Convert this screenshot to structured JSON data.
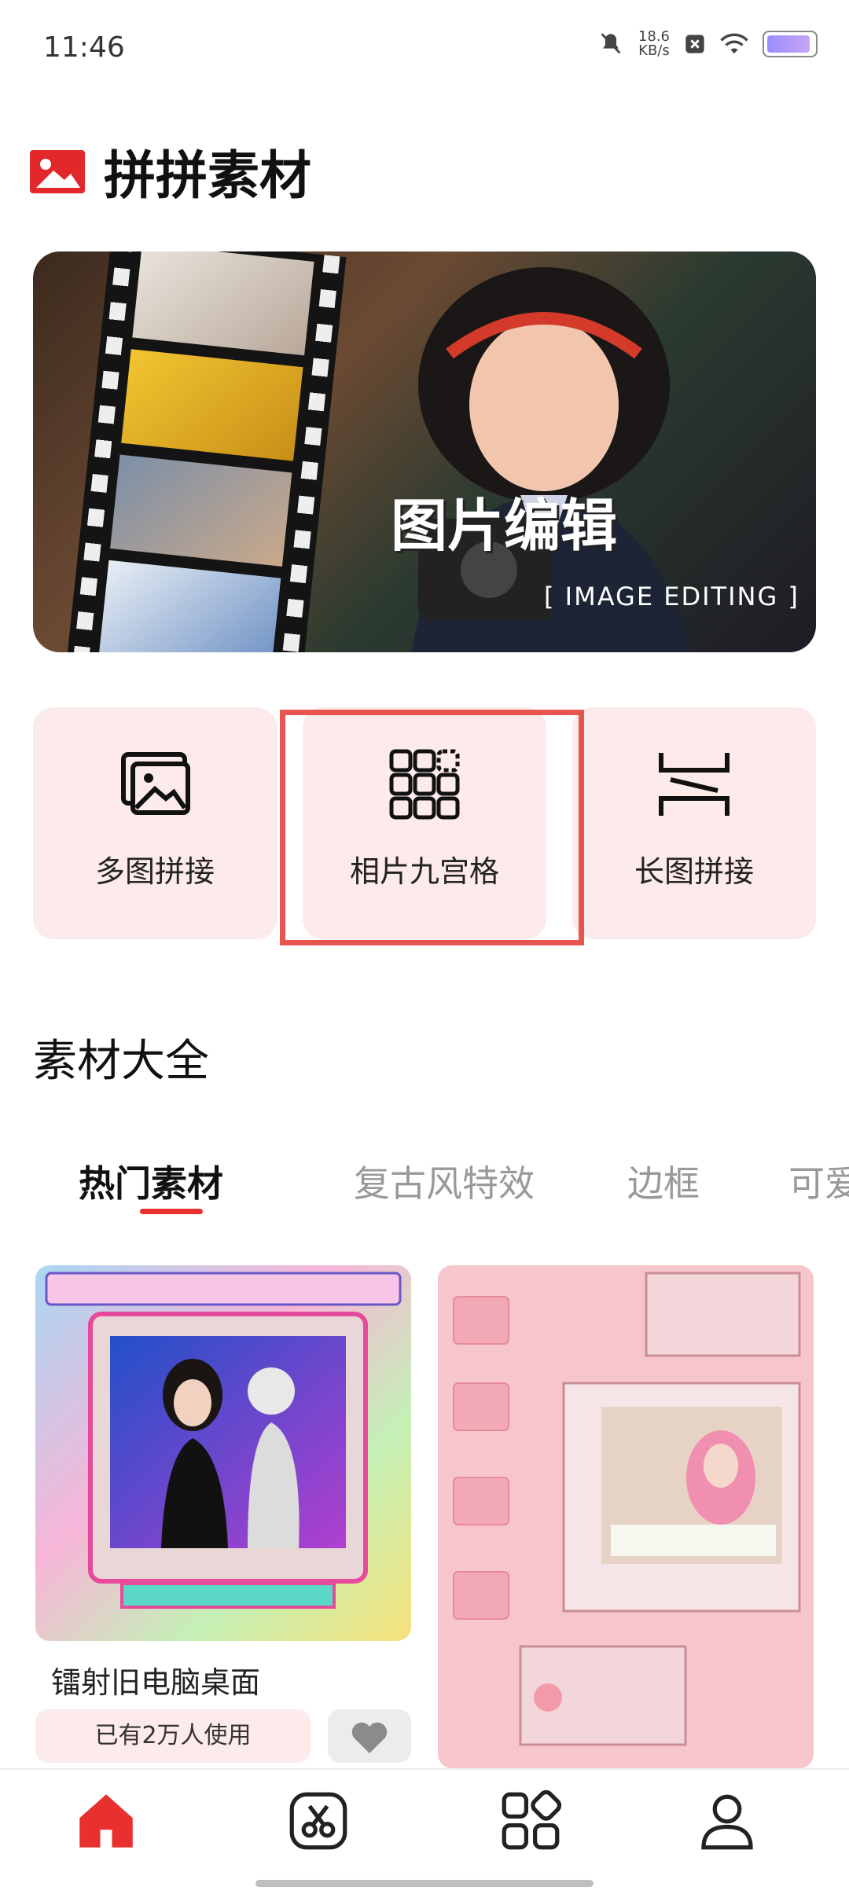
{
  "status_bar": {
    "time": "11:46",
    "net_speed_value": "18.6",
    "net_speed_unit": "KB/s"
  },
  "header": {
    "title": "拼拼素材"
  },
  "banner": {
    "title": "图片编辑",
    "subtitle": "[ IMAGE EDITING ]"
  },
  "tools": [
    {
      "label": "多图拼接",
      "icon": "image-icon"
    },
    {
      "label": "相片九宫格",
      "icon": "grid-icon"
    },
    {
      "label": "长图拼接",
      "icon": "long-image-icon"
    }
  ],
  "section": {
    "title": "素材大全"
  },
  "tabs": [
    {
      "label": "热门素材",
      "active": true
    },
    {
      "label": "复古风特效",
      "active": false
    },
    {
      "label": "边框",
      "active": false
    },
    {
      "label": "可爱",
      "active": false
    }
  ],
  "cards": [
    {
      "name": "镭射旧电脑桌面",
      "usage": "已有2万人使用"
    }
  ],
  "bottom_nav": [
    {
      "icon": "home-icon",
      "active": true
    },
    {
      "icon": "scissors-icon",
      "active": false
    },
    {
      "icon": "apps-icon",
      "active": false
    },
    {
      "icon": "profile-icon",
      "active": false
    }
  ],
  "colors": {
    "accent": "#e8302f",
    "card_bg": "#fdeaea",
    "highlight": "#e85450"
  }
}
